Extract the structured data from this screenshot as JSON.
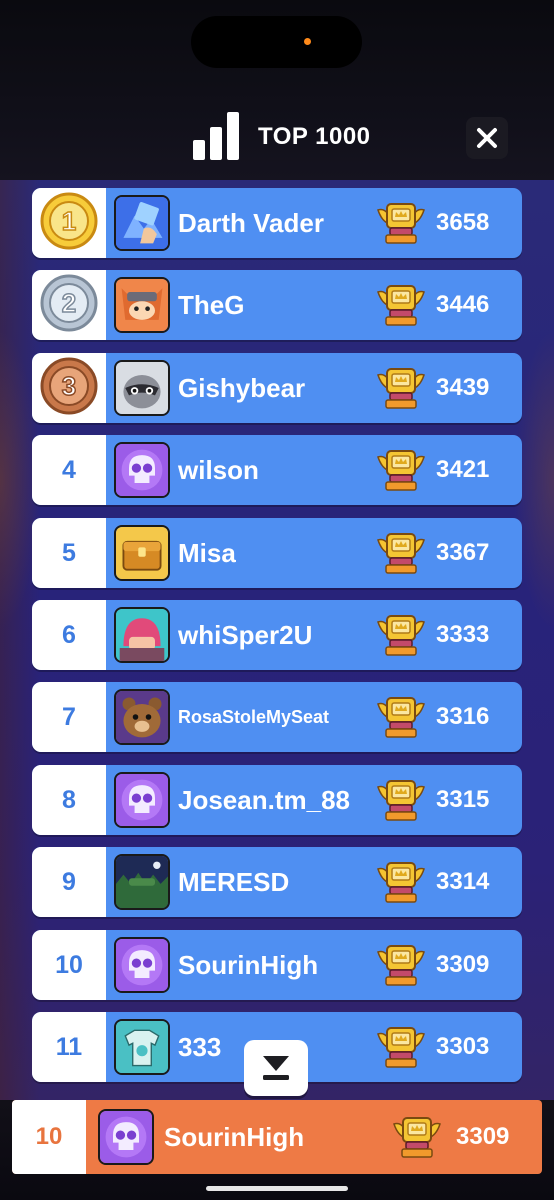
{
  "header": {
    "title": "TOP 1000",
    "icon": "leaderboard-bars-icon",
    "close_icon": "close-icon"
  },
  "leaderboard": [
    {
      "rank": "1",
      "medal": "gold",
      "name": "Darth Vader",
      "score": "3658",
      "avatar": "gallery-icon"
    },
    {
      "rank": "2",
      "medal": "silver",
      "name": "TheG",
      "score": "3446",
      "avatar": "fox-avatar"
    },
    {
      "rank": "3",
      "medal": "bronze",
      "name": "Gishybear",
      "score": "3439",
      "avatar": "raccoon-avatar"
    },
    {
      "rank": "4",
      "medal": "",
      "name": "wilson",
      "score": "3421",
      "avatar": "skull-avatar"
    },
    {
      "rank": "5",
      "medal": "",
      "name": "Misa",
      "score": "3367",
      "avatar": "chest-avatar"
    },
    {
      "rank": "6",
      "medal": "",
      "name": "whiSper2U",
      "score": "3333",
      "avatar": "pink-hair-avatar"
    },
    {
      "rank": "7",
      "medal": "",
      "name": "RosaStoleMySeat",
      "score": "3316",
      "avatar": "bear-avatar"
    },
    {
      "rank": "8",
      "medal": "",
      "name": "Josean.tm_88",
      "score": "3315",
      "avatar": "skull-avatar"
    },
    {
      "rank": "9",
      "medal": "",
      "name": "MERESD",
      "score": "3314",
      "avatar": "forest-avatar"
    },
    {
      "rank": "10",
      "medal": "",
      "name": "SourinHigh",
      "score": "3309",
      "avatar": "skull-avatar"
    },
    {
      "rank": "11",
      "medal": "",
      "name": "333",
      "score": "3303",
      "avatar": "shirt-avatar"
    }
  ],
  "current_player": {
    "rank": "10",
    "name": "SourinHigh",
    "score": "3309",
    "avatar": "skull-avatar"
  },
  "scroll_button_icon": "scroll-down-icon",
  "colors": {
    "row_blue": "#4f8ff2",
    "rank_blue": "#3d7be0",
    "me_orange": "#ee7a45",
    "panel_purple": "#28237a"
  }
}
